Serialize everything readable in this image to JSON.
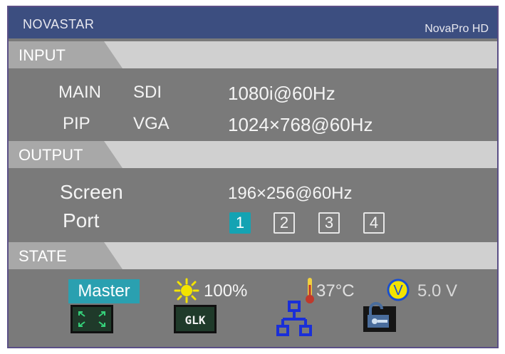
{
  "header": {
    "brand": "NOVASTAR",
    "model": "NovaPro HD"
  },
  "input": {
    "section_label": "INPUT",
    "rows": [
      {
        "slot": "MAIN",
        "source": "SDI",
        "format": "1080i@60Hz"
      },
      {
        "slot": "PIP",
        "source": "VGA",
        "format": "1024×768@60Hz"
      }
    ]
  },
  "output": {
    "section_label": "OUTPUT",
    "screen_label": "Screen",
    "screen_value": "196×256@60Hz",
    "port_label": "Port",
    "ports": [
      "1",
      "2",
      "3",
      "4"
    ],
    "active_port": "1"
  },
  "state": {
    "section_label": "STATE",
    "role": "Master",
    "brightness": "100%",
    "temperature": "37°C",
    "voltage": "5.0 V",
    "icons": [
      "fullscreen-icon",
      "glk-icon",
      "network-icon",
      "lock-icon"
    ],
    "colors": {
      "accent": "#14a3b3",
      "header": "#3c4e80",
      "sun": "#f3e300"
    }
  }
}
